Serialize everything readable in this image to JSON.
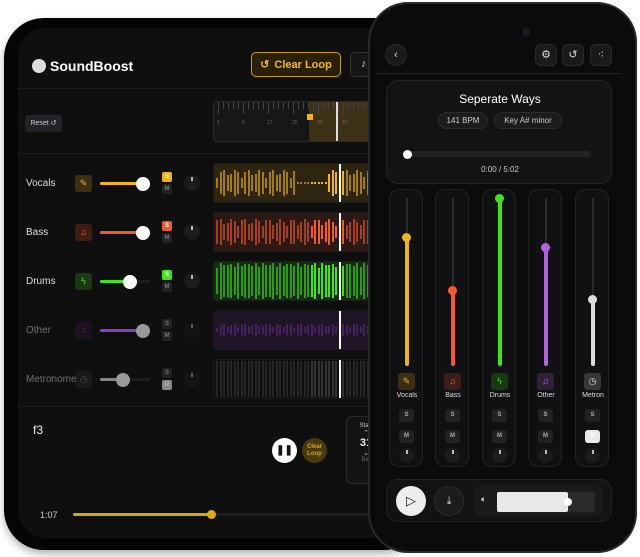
{
  "tablet": {
    "brand": "SoundBoost",
    "clear_loop": "Clear Loop",
    "reset": "Reset",
    "ruler_ticks": [
      "1",
      "9",
      "17",
      "25",
      "33",
      "41"
    ],
    "tracks": [
      {
        "name": "Vocals",
        "color": "#f0b41a",
        "volume": 0.85,
        "solo": "S",
        "mute": "M",
        "icon": "pencil-icon",
        "glyph": "✎"
      },
      {
        "name": "Bass",
        "color": "#f25a2c",
        "volume": 0.85,
        "solo": "S",
        "mute": "M",
        "icon": "music-note-icon",
        "glyph": "♫"
      },
      {
        "name": "Drums",
        "color": "#3fe51a",
        "volume": 0.6,
        "solo": "S",
        "mute": "M",
        "icon": "bolt-icon",
        "glyph": "ϟ"
      },
      {
        "name": "Other",
        "color": "#8a3fc0",
        "volume": 0.85,
        "solo": "S",
        "mute": "M",
        "icon": "music-note-icon",
        "glyph": "♫"
      },
      {
        "name": "Metronome",
        "color": "#888888",
        "volume": 0.45,
        "solo": "S",
        "mute": "M",
        "icon": "clock-icon",
        "glyph": "◷"
      }
    ],
    "chord": "f3",
    "clear_loop_small": "Clear Loop",
    "start_label": "Start",
    "start_value": "31",
    "bar_label": "Bar",
    "time": "1:07",
    "progress": 0.4
  },
  "phone": {
    "song_title": "Seperate Ways",
    "bpm": "141 BPM",
    "key": "Key A# minor",
    "time": "0:00 / 5:02",
    "progress": 0.0,
    "channels": [
      {
        "name": "Vocals",
        "color": "#f0b41a",
        "level": 0.77,
        "glyph": "✎",
        "icon": "pencil-icon",
        "mute_active": false
      },
      {
        "name": "Bass",
        "color": "#f25a2c",
        "level": 0.45,
        "glyph": "♫",
        "icon": "music-note-icon",
        "mute_active": false
      },
      {
        "name": "Drums",
        "color": "#3fe51a",
        "level": 1.0,
        "glyph": "ϟ",
        "icon": "bolt-icon",
        "mute_active": false
      },
      {
        "name": "Other",
        "color": "#b45ee0",
        "level": 0.71,
        "glyph": "♫",
        "icon": "music-note-icon",
        "mute_active": false
      },
      {
        "name": "Metron",
        "color": "#dddddd",
        "level": 0.4,
        "glyph": "◷",
        "icon": "clock-icon",
        "mute_active": true
      }
    ],
    "solo": "S",
    "mute": "M",
    "volume": 0.72
  }
}
